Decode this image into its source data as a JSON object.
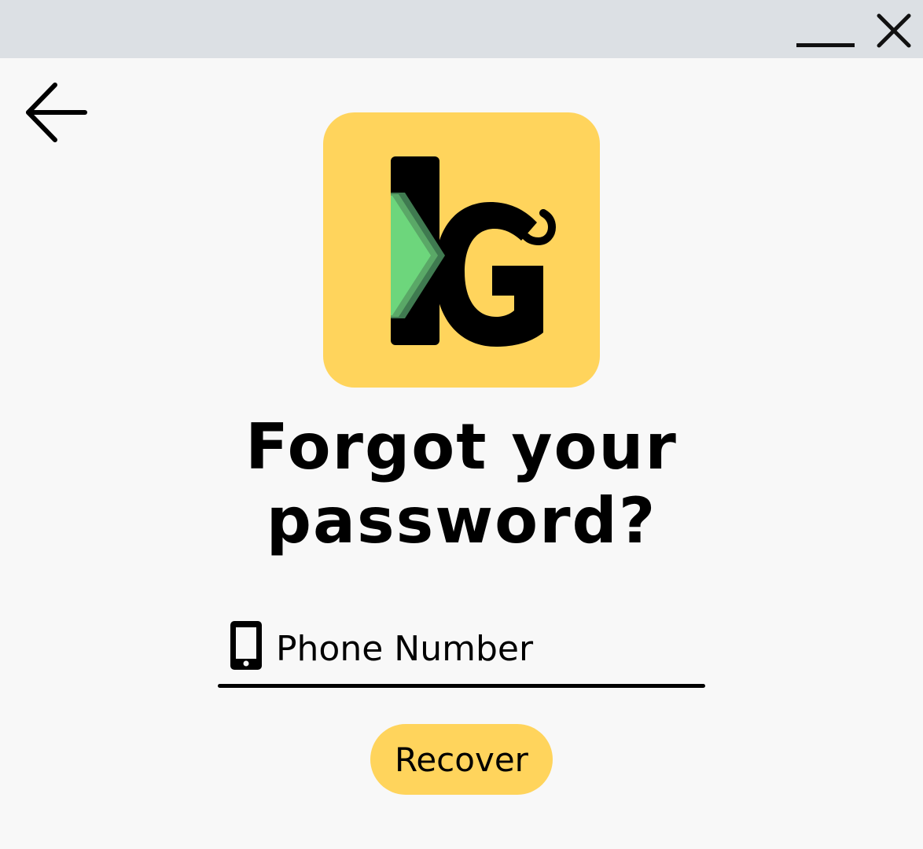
{
  "window": {
    "minimize_icon": "minimize-icon",
    "close_icon": "close-icon"
  },
  "nav": {
    "back_icon": "arrow-left-icon"
  },
  "logo": {
    "icon": "app-logo",
    "background_color": "#ffd45c",
    "accent_color": "#6dd67c"
  },
  "heading": {
    "line1": "Forgot your",
    "line2": "password?"
  },
  "phone_field": {
    "icon": "smartphone-icon",
    "placeholder": "Phone Number",
    "value": ""
  },
  "recover_button": {
    "label": "Recover",
    "color": "#ffd45c"
  }
}
